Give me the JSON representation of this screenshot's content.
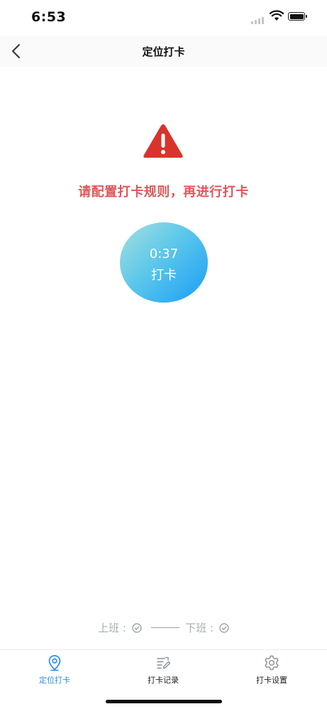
{
  "status_bar": {
    "time": "6:53"
  },
  "nav": {
    "title": "定位打卡",
    "back_icon": "chevron-left-icon"
  },
  "warning": {
    "icon": "warning-triangle-icon",
    "message": "请配置打卡规则，再进行打卡",
    "color": "#e0575a"
  },
  "punch": {
    "time": "0:37",
    "label": "打卡"
  },
  "shift": {
    "on_label": "上班 :",
    "off_label": "下班 :"
  },
  "tabs": [
    {
      "label": "定位打卡",
      "icon": "location-pin-icon",
      "active": true
    },
    {
      "label": "打卡记录",
      "icon": "records-icon",
      "active": false
    },
    {
      "label": "打卡设置",
      "icon": "gear-icon",
      "active": false
    }
  ],
  "colors": {
    "accent": "#2d8ce6",
    "punch_gradient_start": "#a6e0de",
    "punch_gradient_end": "#1a9df6"
  }
}
